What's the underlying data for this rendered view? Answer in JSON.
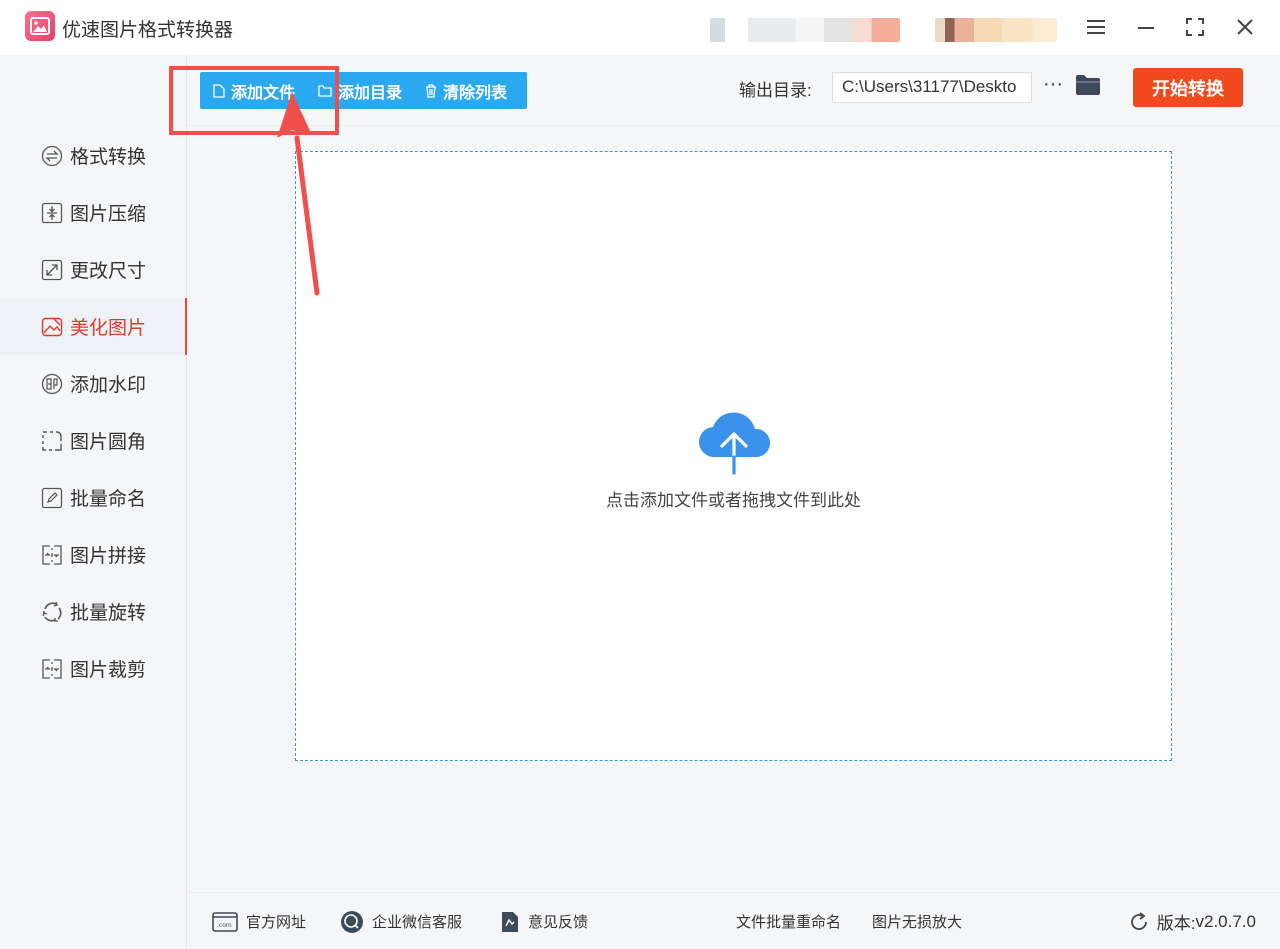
{
  "app": {
    "title": "优速图片格式转换器",
    "icon": "image-app-icon"
  },
  "window_controls": [
    "menu-icon",
    "minimize-icon",
    "maximize-icon",
    "close-icon"
  ],
  "sidebar": {
    "items": [
      {
        "label": "格式转换",
        "icon": "convert-icon",
        "active": false
      },
      {
        "label": "图片压缩",
        "icon": "compress-icon",
        "active": false
      },
      {
        "label": "更改尺寸",
        "icon": "resize-icon",
        "active": false
      },
      {
        "label": "美化图片",
        "icon": "beautify-icon",
        "active": true
      },
      {
        "label": "添加水印",
        "icon": "watermark-icon",
        "active": false
      },
      {
        "label": "图片圆角",
        "icon": "round-corner-icon",
        "active": false
      },
      {
        "label": "批量命名",
        "icon": "rename-icon",
        "active": false
      },
      {
        "label": "图片拼接",
        "icon": "splice-icon",
        "active": false
      },
      {
        "label": "批量旋转",
        "icon": "rotate-icon",
        "active": false
      },
      {
        "label": "图片裁剪",
        "icon": "crop-icon",
        "active": false
      }
    ]
  },
  "toolbar": {
    "add_file": "添加文件",
    "add_dir": "添加目录",
    "clear_list": "清除列表",
    "output_label": "输出目录:",
    "output_path": "C:\\Users\\31177\\Deskto",
    "more": "···",
    "start": "开始转换"
  },
  "dropzone": {
    "hint": "点击添加文件或者拖拽文件到此处",
    "icon": "cloud-upload-icon"
  },
  "footer": {
    "website": "官方网址",
    "wechat_service": "企业微信客服",
    "feedback": "意见反馈",
    "batch_rename": "文件批量重命名",
    "lossless_enlarge": "图片无损放大",
    "version_label": "版本:",
    "version": "v2.0.7.0"
  },
  "colors": {
    "accent_blue": "#2aa8f0",
    "start_red": "#f04a1e",
    "active_red": "#e23a2a",
    "annotation_red": "#f0504c",
    "cloud_blue": "#3a92ea"
  }
}
